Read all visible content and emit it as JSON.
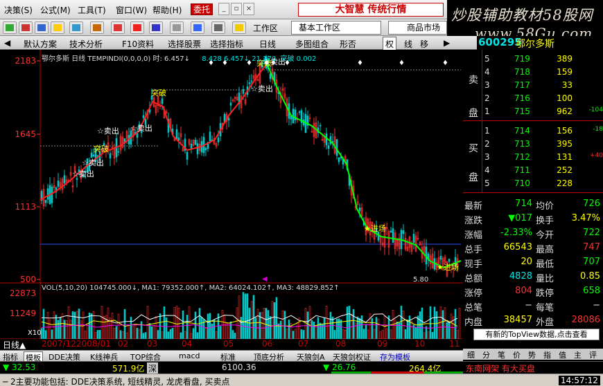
{
  "menu": {
    "items": [
      "决策(S)",
      "公式(M)",
      "工具(T)",
      "窗口(W)",
      "帮助(H)"
    ],
    "trade": "委托",
    "logo": "大智慧 传统行情"
  },
  "watermark": {
    "line1": "炒股辅助教材58股网",
    "line2": "www.58Gu.com"
  },
  "toolbar": {
    "workzone_label": "工作区",
    "workzone_value": "基本工作区",
    "market": "商品市场"
  },
  "tabs": [
    "默认方案",
    "技术分析",
    "F10资料",
    "选择股票",
    "选择指标",
    "日线",
    "多图组合",
    "形否",
    "权",
    "线",
    "移"
  ],
  "stock": {
    "code": "600295",
    "name": "鄂尔多斯",
    "period": "日线"
  },
  "chart": {
    "title_formula": "鄂尔多斯 日线 TEMPINDI(0,0,0,0) 时: 6.457↓",
    "title_extra": "8.428 6.457↓ 21.170, 突破 0.002",
    "price_axis": [
      "2183",
      "1645",
      "1113",
      "500"
    ],
    "top_label": "5.80",
    "annotations": [
      {
        "t": "☆卖出"
      },
      {
        "t": "☆卖出"
      },
      {
        "t": "☆卖出"
      },
      {
        "t": "突破"
      },
      {
        "t": "☆卖出"
      },
      {
        "t": "突破"
      },
      {
        "t": "☆卖出"
      },
      {
        "t": "突破"
      },
      {
        "t": "☆卖出"
      },
      {
        "t": "★进场"
      },
      {
        "t": "★进场"
      }
    ],
    "vol_title": "VOL(5,10,20) 104745.000↓, MA1: 79352.000↑, MA2: 64024.102↑, MA3: 48829.852↑",
    "vol_axis": [
      "22873",
      "11249",
      "X10"
    ]
  },
  "orderbook": {
    "sell_side": "卖盘",
    "buy_side": "买盘",
    "sell": [
      {
        "n": "5",
        "p": "719",
        "v": "389",
        "d": ""
      },
      {
        "n": "4",
        "p": "718",
        "v": "159",
        "d": ""
      },
      {
        "n": "3",
        "p": "717",
        "v": "33",
        "d": ""
      },
      {
        "n": "2",
        "p": "716",
        "v": "100",
        "d": ""
      },
      {
        "n": "1",
        "p": "715",
        "v": "962",
        "d": "-104"
      }
    ],
    "buy": [
      {
        "n": "1",
        "p": "714",
        "v": "156",
        "d": "-18"
      },
      {
        "n": "2",
        "p": "713",
        "v": "395",
        "d": ""
      },
      {
        "n": "3",
        "p": "712",
        "v": "131",
        "d": "+40"
      },
      {
        "n": "4",
        "p": "711",
        "v": "252",
        "d": ""
      },
      {
        "n": "5",
        "p": "710",
        "v": "228",
        "d": ""
      }
    ]
  },
  "quote": [
    {
      "l1": "最新",
      "v1": "714",
      "c1": "#00ff00",
      "l2": "均价",
      "v2": "726",
      "c2": "#00ff00"
    },
    {
      "l1": "涨跌",
      "v1": "▼017",
      "c1": "#00ff00",
      "l2": "换手",
      "v2": "3.47%",
      "c2": "#ffff00"
    },
    {
      "l1": "涨幅",
      "v1": "-2.33%",
      "c1": "#00ff00",
      "l2": "今开",
      "v2": "722",
      "c2": "#00ff00"
    },
    {
      "l1": "总手",
      "v1": "66543",
      "c1": "#ffff00",
      "l2": "最高",
      "v2": "747",
      "c2": "#ff3030"
    },
    {
      "l1": "现手",
      "v1": "20",
      "c1": "#ffff00",
      "l2": "最低",
      "v2": "707",
      "c2": "#00ff00"
    },
    {
      "l1": "总额",
      "v1": "4828",
      "c1": "#00e6e6",
      "l2": "量比",
      "v2": "0.85",
      "c2": "#ffff00"
    },
    {
      "l1": "涨停",
      "v1": "804",
      "c1": "#ff3030",
      "l2": "跌停",
      "v2": "658",
      "c2": "#00ff00"
    },
    {
      "l1": "总笔",
      "v1": "−",
      "c1": "#ddd",
      "l2": "每笔",
      "v2": "−",
      "c2": "#ddd"
    },
    {
      "l1": "内盘",
      "v1": "38457",
      "c1": "#ffff00",
      "l2": "外盘",
      "v2": "28086",
      "c2": "#ff3030"
    }
  ],
  "notice": "有新的TopView数据,点击查看",
  "right_tabs": [
    "细",
    "分",
    "笔",
    "价",
    "势",
    "指",
    "值",
    "主",
    "评"
  ],
  "timeaxis": [
    "日线▲",
    "2007/12",
    "2008/01",
    "02",
    "03",
    "04",
    "05",
    "06",
    "07",
    "08",
    "09",
    "10",
    "11"
  ],
  "low_tabs": [
    "指标",
    "模板",
    "DDE决策",
    "K线神兵",
    "TOP综合",
    "macd",
    "标准",
    "顶底分析",
    "天狼剑A",
    "天狼剑权证",
    "存为模板"
  ],
  "index_bar": {
    "a": "▼ 32.53",
    "b": "571.9亿",
    "c": "深",
    "d": "6100.36",
    "e": "▼ 26.76",
    "f": "264.4亿",
    "g": "东南网架 有大买盘"
  },
  "status": {
    "msg": "─ 2主要功能包括: DDE决策系统, 短线精灵, 龙虎看盘, 买卖点",
    "time": "14:57:12"
  }
}
